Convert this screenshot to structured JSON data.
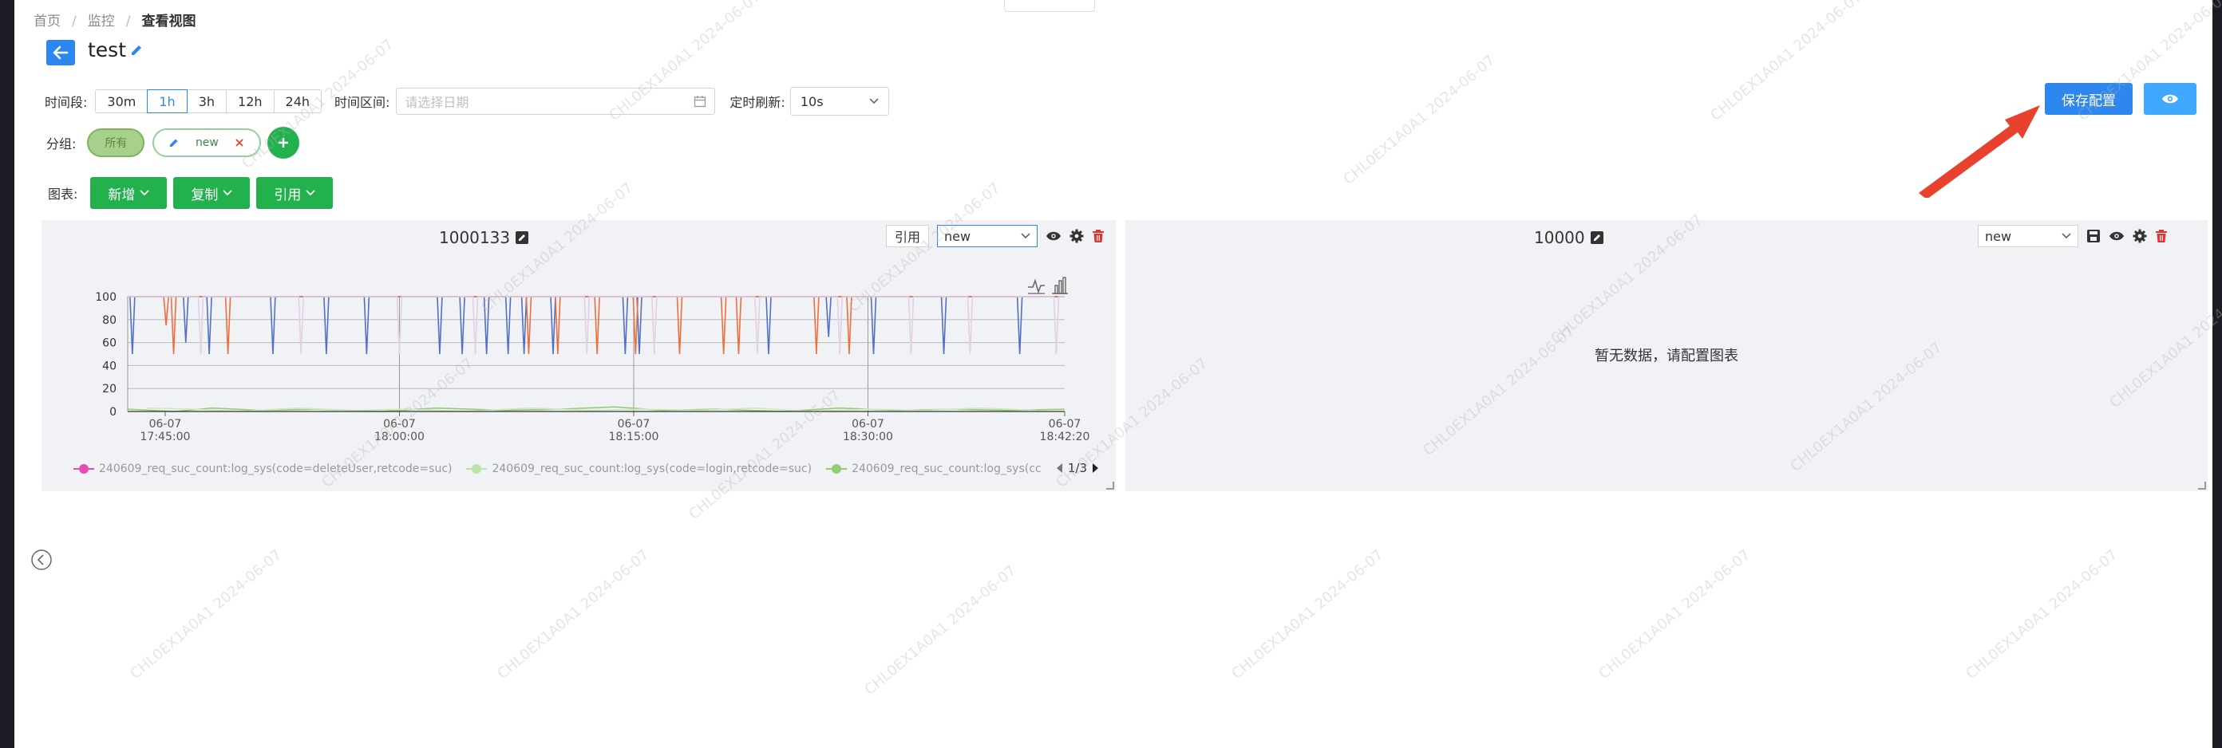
{
  "breadcrumb": [
    "首页",
    "监控",
    "查看视图"
  ],
  "page": {
    "title": "test"
  },
  "toolbar": {
    "time_label": "时间段:",
    "ranges": [
      "30m",
      "1h",
      "3h",
      "12h",
      "24h"
    ],
    "active_range": "1h",
    "interval_label": "时间区间:",
    "date_placeholder": "请选择日期",
    "refresh_label": "定时刷新:",
    "refresh_value": "10s",
    "save_label": "保存配置"
  },
  "group": {
    "label": "分组:",
    "all": "所有",
    "new": "new"
  },
  "charts_row": {
    "label": "图表:",
    "add": "新增",
    "copy": "复制",
    "ref": "引用"
  },
  "panels": [
    {
      "title": "1000133",
      "ref_label": "引用",
      "select": "new",
      "legend": [
        {
          "name": "240609_req_suc_count:log_sys(code=deleteUser,retcode=suc)",
          "color": "#e64eb3"
        },
        {
          "name": "240609_req_suc_count:log_sys(code=login,retcode=suc)",
          "color": "#b9e3a7"
        },
        {
          "name": "240609_req_suc_count:log_sys(cc",
          "color": "#91cc75"
        }
      ],
      "pager": "1/3"
    },
    {
      "title": "10000",
      "select": "new",
      "empty": "暂无数据，请配置图表"
    }
  ],
  "watermark_text": "CHL0EX1A0A1  2024-06-07",
  "chart_data": {
    "type": "line",
    "ylim": [
      0,
      100
    ],
    "yticks": [
      0,
      20,
      40,
      60,
      80,
      100
    ],
    "x_ticks": [
      "06-07\n17:45:00",
      "06-07\n18:00:00",
      "06-07\n18:15:00",
      "06-07\n18:30:00",
      "06-07\n18:42:20"
    ],
    "xlabel": "",
    "ylabel": "",
    "series": [
      {
        "color": "#5470c6",
        "baseline": 100,
        "dips": [
          [
            0.5,
            50
          ],
          [
            6.2,
            60
          ],
          [
            8.7,
            50
          ],
          [
            15.5,
            50
          ],
          [
            21.2,
            50
          ],
          [
            25.5,
            50
          ],
          [
            33.3,
            50
          ],
          [
            35.7,
            50
          ],
          [
            38.3,
            50
          ],
          [
            40.6,
            50
          ],
          [
            42.3,
            50
          ],
          [
            45.4,
            50
          ],
          [
            53.1,
            50
          ],
          [
            54.6,
            50
          ],
          [
            68.4,
            50
          ],
          [
            74.8,
            65
          ],
          [
            79.6,
            50
          ],
          [
            87.1,
            50
          ],
          [
            95.2,
            50
          ]
        ]
      },
      {
        "color": "#ee6e3c",
        "baseline": 100,
        "dips": [
          [
            4.1,
            75
          ],
          [
            4.9,
            50
          ],
          [
            10.7,
            50
          ],
          [
            42.8,
            50
          ],
          [
            45.9,
            50
          ],
          [
            50.1,
            50
          ],
          [
            54.2,
            50
          ],
          [
            58.9,
            50
          ],
          [
            63.6,
            50
          ],
          [
            65.2,
            50
          ],
          [
            73.5,
            50
          ],
          [
            77.0,
            50
          ]
        ]
      },
      {
        "color": "#e4cfe7",
        "baseline": 100,
        "dips": [
          [
            7.8,
            50
          ],
          [
            18.5,
            50
          ],
          [
            29.0,
            50
          ],
          [
            37.1,
            50
          ],
          [
            49.0,
            50
          ],
          [
            56.2,
            50
          ],
          [
            67.2,
            50
          ],
          [
            76.0,
            50
          ],
          [
            83.6,
            50
          ],
          [
            89.9,
            50
          ],
          [
            99.1,
            50
          ]
        ]
      },
      {
        "color": "#91cc75",
        "baseline": 1,
        "dips": [
          [
            0,
            2
          ],
          [
            5,
            0
          ],
          [
            9,
            3
          ],
          [
            14,
            1
          ],
          [
            20,
            2
          ],
          [
            27,
            0
          ],
          [
            33,
            3
          ],
          [
            40,
            1
          ],
          [
            46,
            2
          ],
          [
            52,
            4
          ],
          [
            57,
            1
          ],
          [
            63,
            2
          ],
          [
            70,
            0
          ],
          [
            76,
            3
          ],
          [
            82,
            1
          ],
          [
            88,
            2
          ],
          [
            94,
            1
          ],
          [
            100,
            2
          ]
        ]
      },
      {
        "color": "#cfe9bf",
        "baseline": 1,
        "dips": [
          [
            2,
            3
          ],
          [
            7,
            2
          ],
          [
            12,
            0
          ],
          [
            18,
            3
          ],
          [
            24,
            1
          ],
          [
            30,
            2
          ],
          [
            36,
            0
          ],
          [
            43,
            3
          ],
          [
            49,
            1
          ],
          [
            55,
            2
          ],
          [
            61,
            1
          ],
          [
            67,
            3
          ],
          [
            73,
            0
          ],
          [
            79,
            2
          ],
          [
            85,
            1
          ],
          [
            91,
            3
          ],
          [
            97,
            1
          ]
        ]
      }
    ]
  }
}
